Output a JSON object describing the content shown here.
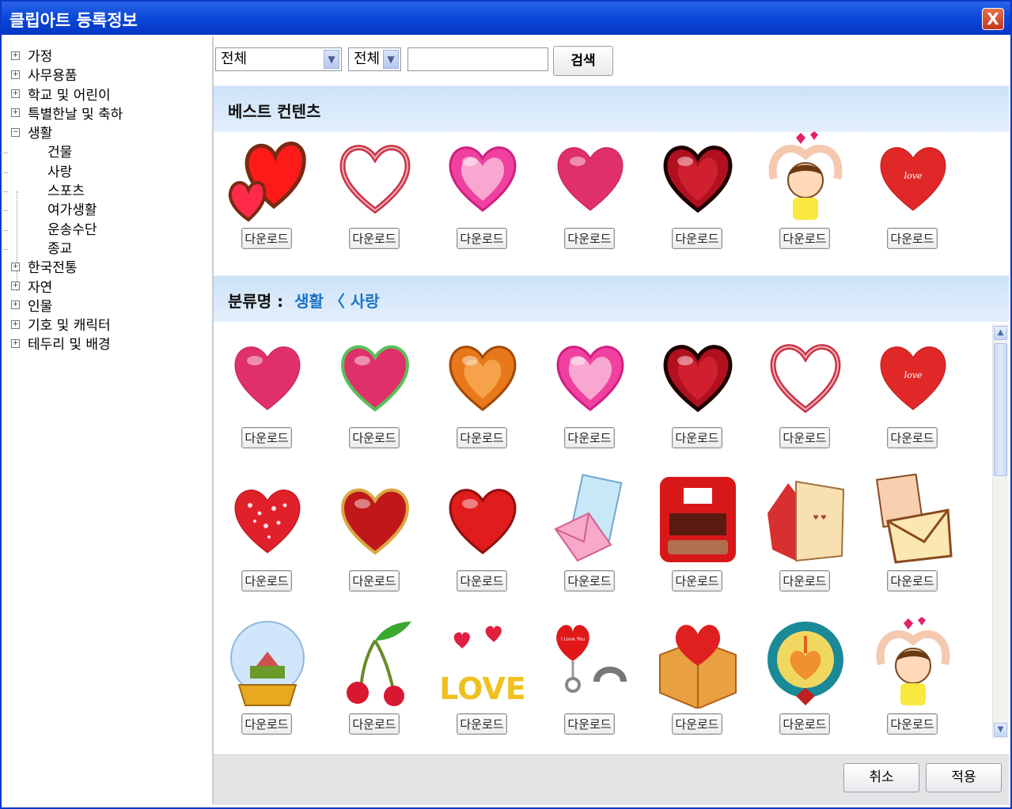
{
  "window": {
    "title": "클립아트 등록정보",
    "close_label": "X"
  },
  "sidebar": {
    "items": [
      {
        "label": "가정",
        "toggle": "+"
      },
      {
        "label": "사무용품",
        "toggle": "+"
      },
      {
        "label": "학교 및 어린이",
        "toggle": "+"
      },
      {
        "label": "특별한날 및 축하",
        "toggle": "+"
      },
      {
        "label": "생활",
        "toggle": "−"
      },
      {
        "label": "건물"
      },
      {
        "label": "사랑"
      },
      {
        "label": "스포츠"
      },
      {
        "label": "여가생활"
      },
      {
        "label": "운송수단"
      },
      {
        "label": "종교"
      },
      {
        "label": "한국전통",
        "toggle": "+"
      },
      {
        "label": "자연",
        "toggle": "+"
      },
      {
        "label": "인물",
        "toggle": "+"
      },
      {
        "label": "기호 및 캐릭터",
        "toggle": "+"
      },
      {
        "label": "테두리 및 배경",
        "toggle": "+"
      }
    ]
  },
  "toolbar": {
    "select1_value": "전체",
    "select2_value": "전체",
    "search_value": "",
    "search_button": "검색"
  },
  "best": {
    "title": "베스트 컨텐츠"
  },
  "category": {
    "prefix": "분류명 :",
    "path": "생활 〈 사랑"
  },
  "download_label": "다운로드",
  "footer": {
    "cancel": "취소",
    "apply": "적용"
  },
  "colors": {
    "title_bar": "#0a47d8",
    "band": "#cde2f8",
    "category_link": "#1a73c8"
  },
  "best_items": [
    "red-heart-pair",
    "glitter-heart-outline",
    "pink-glossy-heart",
    "rose-heart",
    "dark-red-heart",
    "girl-heart-arms",
    "love-heart"
  ],
  "category_items": [
    "rose-heart",
    "green-outline-heart",
    "orange-heart",
    "pink-glossy-heart",
    "dark-red-heart",
    "glitter-heart-outline",
    "love-heart",
    "dotted-heart",
    "gold-rim-heart",
    "shiny-red-heart",
    "love-letter",
    "red-mailbox",
    "greeting-card",
    "envelope-letter",
    "snow-globe",
    "cherry",
    "love-text",
    "heart-balloon-handcuff",
    "heart-gift-box",
    "love-wreath",
    "girl-heart-arms"
  ]
}
